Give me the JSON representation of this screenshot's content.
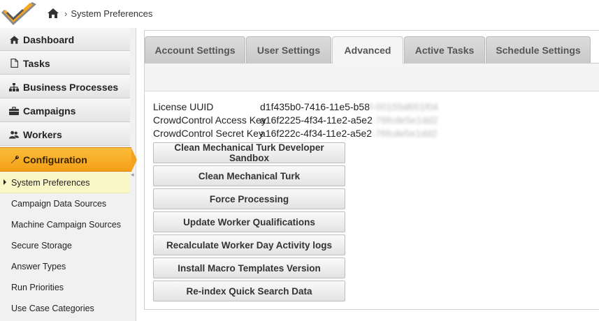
{
  "breadcrumb": {
    "current": "System Preferences"
  },
  "sidebar": {
    "items": [
      {
        "label": "Dashboard",
        "icon": "home-icon"
      },
      {
        "label": "Tasks",
        "icon": "document-icon"
      },
      {
        "label": "Business Processes",
        "icon": "sitemap-icon"
      },
      {
        "label": "Campaigns",
        "icon": "briefcase-icon"
      },
      {
        "label": "Workers",
        "icon": "users-icon"
      }
    ],
    "active_section": {
      "label": "Configuration",
      "icon": "wrench-icon"
    },
    "sub_items": [
      "System Preferences",
      "Campaign Data Sources",
      "Machine Campaign Sources",
      "Secure Storage",
      "Answer Types",
      "Run Priorities",
      "Use Case Categories"
    ]
  },
  "tabs": [
    "Account Settings",
    "User Settings",
    "Advanced",
    "Active Tasks",
    "Schedule Settings"
  ],
  "active_tab": "Advanced",
  "info": [
    {
      "label": "License UUID",
      "value": "d1f435b0-7416-11e5-b58",
      "hidden": "f-00155d651f04"
    },
    {
      "label": "CrowdControl Access Key",
      "value": "a16f2225-4f34-11e2-a5e2",
      "hidden": "-76fcde5e1dd2"
    },
    {
      "label": "CrowdControl Secret Key",
      "value": "a16f222c-4f34-11e2-a5e2",
      "hidden": "-76fcde5e1dd2"
    }
  ],
  "buttons": [
    "Clean Mechanical Turk Developer Sandbox",
    "Clean Mechanical Turk",
    "Force Processing",
    "Update Worker Qualifications",
    "Recalculate Worker Day Activity logs",
    "Install Macro Templates Version",
    "Re-index Quick Search Data"
  ],
  "colors": {
    "accent": "#f5a623",
    "highlight": "#fbf6c6"
  }
}
